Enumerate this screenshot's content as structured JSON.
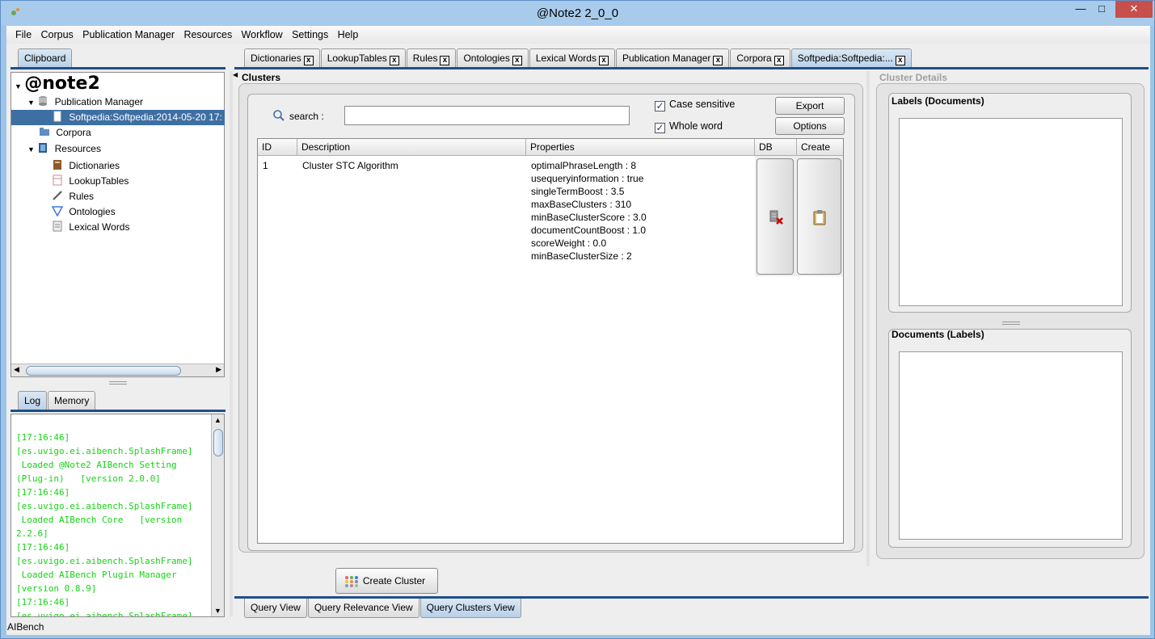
{
  "window": {
    "title": "@Note2 2_0_0",
    "status_bar": "AIBench"
  },
  "menu": [
    "File",
    "Corpus",
    "Publication Manager",
    "Resources",
    "Workflow",
    "Settings",
    "Help"
  ],
  "clipboard": {
    "tab": "Clipboard",
    "root": "@note2",
    "items": {
      "publication_manager": "Publication Manager",
      "selected_item": "Softpedia:Softpedia:2014-05-20 17:",
      "corpora": "Corpora",
      "resources": "Resources",
      "dictionaries": "Dictionaries",
      "lookup_tables": "LookupTables",
      "rules": "Rules",
      "ontologies": "Ontologies",
      "lexical_words": "Lexical Words"
    }
  },
  "log": {
    "tabs": [
      "Log",
      "Memory"
    ],
    "text": "[17:16:46]\n[es.uvigo.ei.aibench.SplashFrame]\n Loaded @Note2 AIBench Setting\n(Plug-in)   [version 2.0.0]\n[17:16:46]\n[es.uvigo.ei.aibench.SplashFrame]\n Loaded AIBench Core   [version\n2.2.6]\n[17:16:46]\n[es.uvigo.ei.aibench.SplashFrame]\n Loaded AIBench Plugin Manager\n[version 0.8.9]\n[17:16:46]\n[es.uvigo.ei.aibench.SplashFrame]"
  },
  "doc_tabs": [
    "Dictionaries",
    "LookupTables",
    "Rules",
    "Ontologies",
    "Lexical Words",
    "Publication Manager",
    "Corpora",
    "Softpedia:Softpedia:..."
  ],
  "clusters": {
    "title": "Clusters",
    "search_label": "search :",
    "search_value": "",
    "case_sensitive": "Case sensitive",
    "whole_word": "Whole word",
    "export": "Export",
    "options": "Options",
    "columns": [
      "ID",
      "Description",
      "Properties",
      "DB",
      "Create"
    ],
    "rows": [
      {
        "id": "1",
        "description": "Cluster STC Algorithm",
        "properties": "optimalPhraseLength : 8\nusequeryinformation : true\nsingleTermBoost : 3.5\nmaxBaseClusters : 310\nminBaseClusterScore : 3.0\ndocumentCountBoost : 1.0\nscoreWeight : 0.0\nminBaseClusterSize : 2"
      }
    ],
    "create_cluster": "Create Cluster"
  },
  "cluster_details": {
    "title": "Cluster Details",
    "labels_documents": "Labels (Documents)",
    "documents_labels": "Documents (Labels)"
  },
  "view_tabs": [
    "Query View",
    "Query Relevance View",
    "Query Clusters View"
  ],
  "colors": {
    "selection": "#3e6fa3",
    "log_text": "#16d316",
    "tab_rule": "#1f4f8a"
  }
}
